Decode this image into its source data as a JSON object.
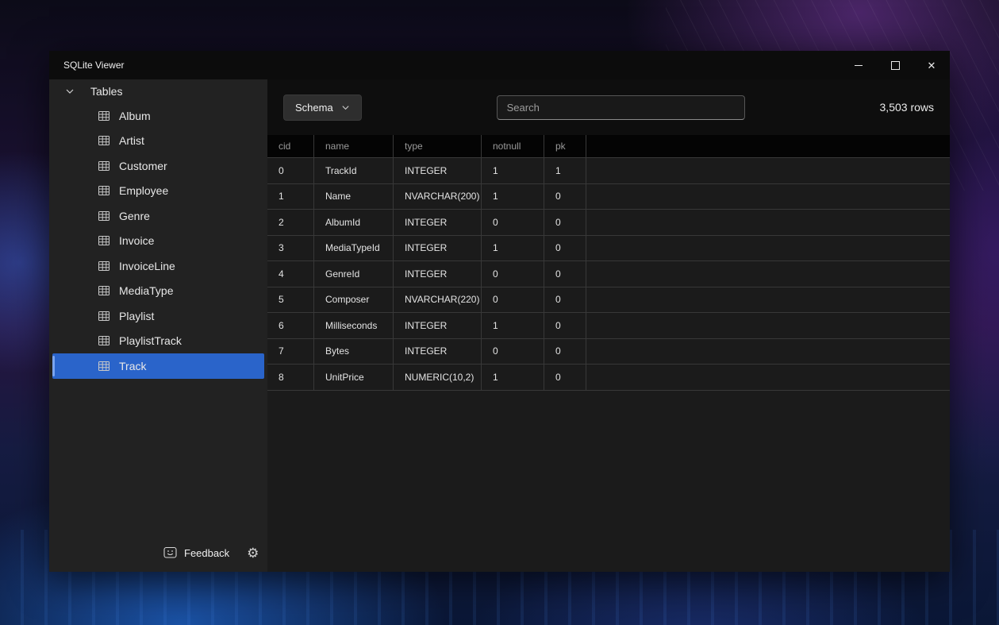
{
  "window": {
    "title": "SQLite Viewer"
  },
  "icons": {
    "close": "✕",
    "gear": "⚙"
  },
  "colors": {
    "accent": "#2a64ca",
    "accent_bar": "#7aa5f0"
  },
  "sidebar": {
    "root_label": "Tables",
    "items": [
      {
        "label": "Album"
      },
      {
        "label": "Artist"
      },
      {
        "label": "Customer"
      },
      {
        "label": "Employee"
      },
      {
        "label": "Genre"
      },
      {
        "label": "Invoice"
      },
      {
        "label": "InvoiceLine"
      },
      {
        "label": "MediaType"
      },
      {
        "label": "Playlist"
      },
      {
        "label": "PlaylistTrack"
      },
      {
        "label": "Track",
        "selected": true
      }
    ],
    "feedback_label": "Feedback"
  },
  "toolbar": {
    "view_selector_label": "Schema",
    "search_placeholder": "Search",
    "row_count": "3,503 rows"
  },
  "table": {
    "columns": [
      "cid",
      "name",
      "type",
      "notnull",
      "pk",
      ""
    ],
    "rows": [
      [
        "0",
        "TrackId",
        "INTEGER",
        "1",
        "1"
      ],
      [
        "1",
        "Name",
        "NVARCHAR(200)",
        "1",
        "0"
      ],
      [
        "2",
        "AlbumId",
        "INTEGER",
        "0",
        "0"
      ],
      [
        "3",
        "MediaTypeId",
        "INTEGER",
        "1",
        "0"
      ],
      [
        "4",
        "GenreId",
        "INTEGER",
        "0",
        "0"
      ],
      [
        "5",
        "Composer",
        "NVARCHAR(220)",
        "0",
        "0"
      ],
      [
        "6",
        "Milliseconds",
        "INTEGER",
        "1",
        "0"
      ],
      [
        "7",
        "Bytes",
        "INTEGER",
        "0",
        "0"
      ],
      [
        "8",
        "UnitPrice",
        "NUMERIC(10,2)",
        "1",
        "0"
      ]
    ]
  }
}
